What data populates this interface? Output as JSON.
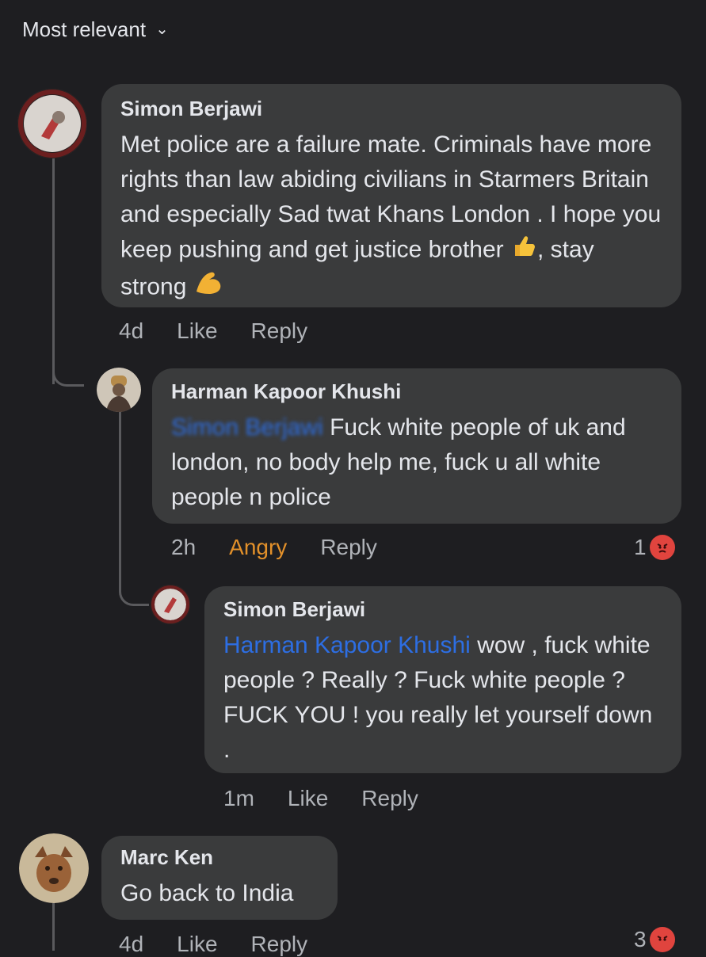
{
  "header": {
    "sort_label": "Most relevant"
  },
  "comments": [
    {
      "author": "Simon Berjawi",
      "text_parts": [
        "Met police are a failure mate. Criminals have more rights than law abiding civilians in Starmers Britain and especially Sad twat Khans London . I hope you keep pushing and get justice brother ",
        ", stay strong "
      ],
      "time": "4d",
      "like_label": "Like",
      "reply_label": "Reply",
      "emojis": [
        "thumbs-up",
        "flexed-biceps"
      ]
    },
    {
      "author": "Harman Kapoor Khushi",
      "mention": "Simon Berjawi",
      "text": "Fuck white people of uk and london, no body help me, fuck u all white people n police",
      "time": "2h",
      "reaction_label": "Angry",
      "reply_label": "Reply",
      "reaction_count": "1",
      "reaction_icon": "angry-face-icon",
      "reaction_color": "#e2902a"
    },
    {
      "author": "Simon Berjawi",
      "mention": "Harman Kapoor Khushi",
      "text": "wow , fuck white people ? Really ? Fuck white people ? FUCK YOU ! you really let yourself down .",
      "time": "1m",
      "like_label": "Like",
      "reply_label": "Reply"
    },
    {
      "author": "Marc Ken",
      "text": "Go back to India",
      "time": "4d",
      "like_label": "Like",
      "reply_label": "Reply",
      "reaction_count": "3",
      "reaction_icon": "angry-face-icon"
    }
  ],
  "colors": {
    "background": "#1e1e21",
    "bubble": "#3a3b3c",
    "mention": "#2d6ee3",
    "meta": "#b0b3b8",
    "angry": "#e2902a"
  }
}
